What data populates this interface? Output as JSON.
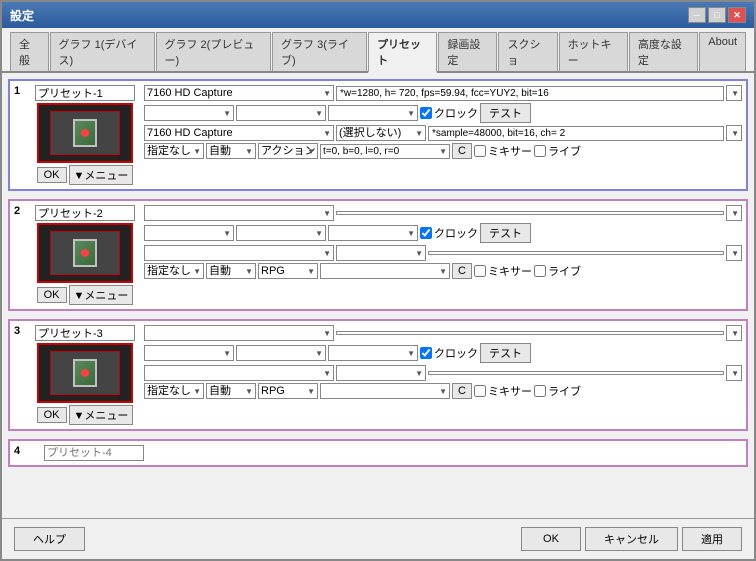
{
  "window": {
    "title": "設定",
    "buttons": {
      "minimize": "─",
      "maximize": "□",
      "close": "✕"
    }
  },
  "tabs": [
    {
      "id": "general",
      "label": "全般"
    },
    {
      "id": "graph1",
      "label": "グラフ 1(デバイス)"
    },
    {
      "id": "graph2",
      "label": "グラフ 2(プレビュー)"
    },
    {
      "id": "graph3",
      "label": "グラフ 3(ライブ)"
    },
    {
      "id": "preset",
      "label": "プリセット",
      "active": true
    },
    {
      "id": "record",
      "label": "録画設定"
    },
    {
      "id": "scene",
      "label": "スクショ"
    },
    {
      "id": "hotkey",
      "label": "ホットキー"
    },
    {
      "id": "advanced",
      "label": "高度な設定"
    },
    {
      "id": "about",
      "label": "About"
    }
  ],
  "presets": [
    {
      "number": "1",
      "name": "プリセット-1",
      "video_device": "7160 HD Capture",
      "video_value": "*w=1280, h= 720, fps=59.94, fcc=YUY2, bit=16",
      "audio_device": "7160 HD Capture",
      "audio_format": "(選択しない)",
      "audio_value": "*sample=48000, bit=16, ch= 2",
      "clock": true,
      "test_label": "テスト",
      "source": "指定なし",
      "mode": "自動",
      "action": "アクション",
      "t_value": "t=0, b=0, l=0, r=0",
      "mixer": false,
      "live": false,
      "ok_label": "OK",
      "menu_label": "▼メニュー"
    },
    {
      "number": "2",
      "name": "プリセット-2",
      "video_device": "",
      "video_value": "",
      "audio_device": "",
      "audio_format": "",
      "audio_value": "",
      "clock": true,
      "test_label": "テスト",
      "source": "指定なし",
      "mode": "自動",
      "action": "RPG",
      "t_value": "",
      "mixer": false,
      "live": false,
      "ok_label": "OK",
      "menu_label": "▼メニュー"
    },
    {
      "number": "3",
      "name": "プリセット-3",
      "video_device": "",
      "video_value": "",
      "audio_device": "",
      "audio_format": "",
      "audio_value": "",
      "clock": true,
      "test_label": "テスト",
      "source": "指定なし",
      "mode": "自動",
      "action": "RPG",
      "t_value": "",
      "mixer": false,
      "live": false,
      "ok_label": "OK",
      "menu_label": "▼メニュー"
    }
  ],
  "bottom": {
    "help": "ヘルプ",
    "ok": "OK",
    "cancel": "キャンセル",
    "apply": "適用"
  },
  "colors": {
    "active_border": "#8080e0",
    "inactive_border": "#c080c0"
  }
}
